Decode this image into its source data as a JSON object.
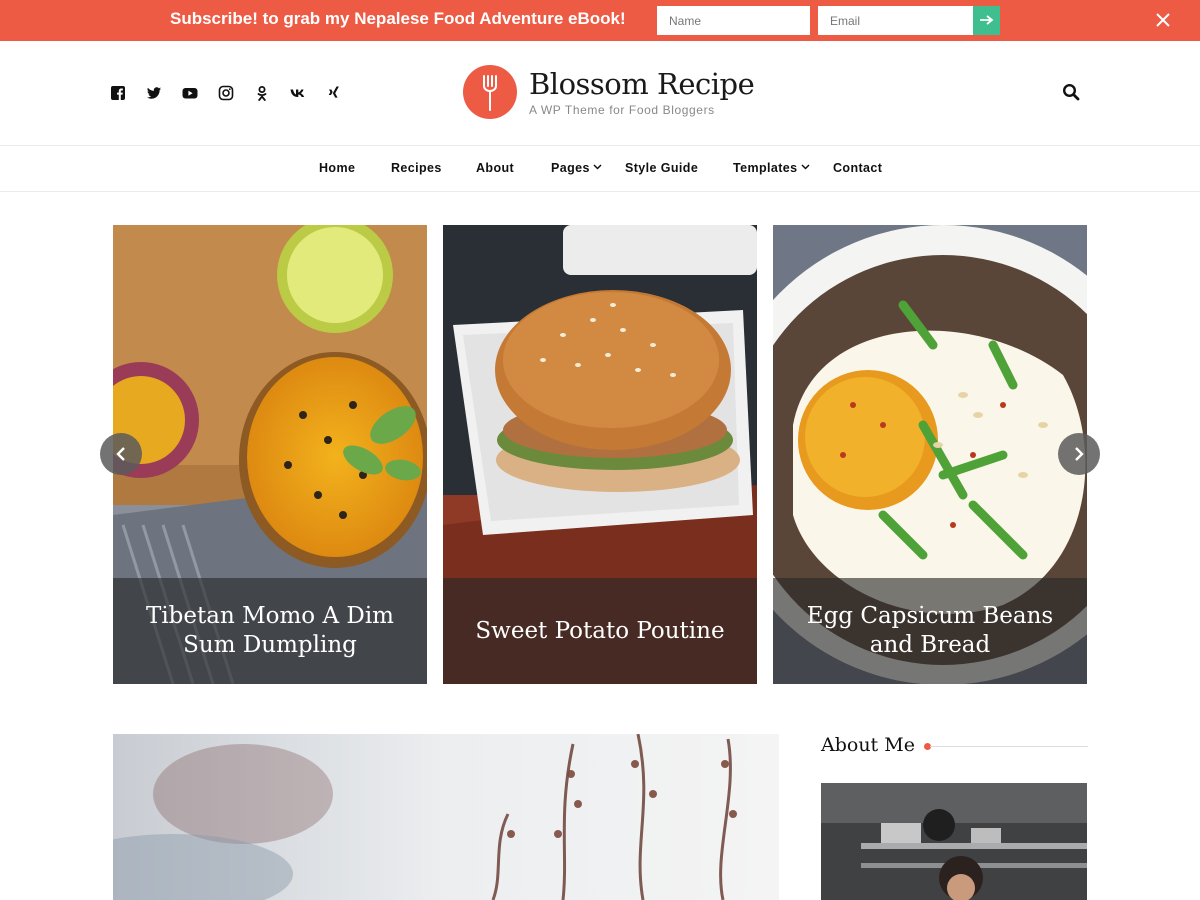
{
  "subscribe_bar": {
    "promo_text": "Subscribe! to grab my Nepalese Food Adventure eBook!",
    "name_placeholder": "Name",
    "email_placeholder": "Email",
    "submit_icon": "arrow-right-icon",
    "close_icon": "close-icon",
    "background_color": "#ee5b45",
    "submit_color": "#3fbf8f"
  },
  "header": {
    "social_icons": [
      "facebook-icon",
      "twitter-icon",
      "youtube-icon",
      "instagram-icon",
      "odnoklassniki-icon",
      "vk-icon",
      "xing-icon"
    ],
    "site_title": "Blossom Recipe",
    "tagline": "A WP Theme for Food Bloggers",
    "logo_icon": "fork-icon",
    "search_icon": "search-icon",
    "accent_color": "#ee5b45"
  },
  "nav": {
    "items": [
      {
        "label": "Home"
      },
      {
        "label": "Recipes"
      },
      {
        "label": "About"
      },
      {
        "label": "Pages",
        "has_dropdown": true
      },
      {
        "label": "Style Guide"
      },
      {
        "label": "Templates",
        "has_dropdown": true
      },
      {
        "label": "Contact"
      }
    ]
  },
  "slider": {
    "slides": [
      {
        "title": "Tibetan Momo A Dim Sum Dumpling"
      },
      {
        "title": "Sweet Potato Poutine"
      },
      {
        "title": "Egg Capsicum Beans and Bread"
      }
    ],
    "prev_icon": "chevron-left-icon",
    "next_icon": "chevron-right-icon"
  },
  "sidebar": {
    "about_title": "About Me"
  }
}
